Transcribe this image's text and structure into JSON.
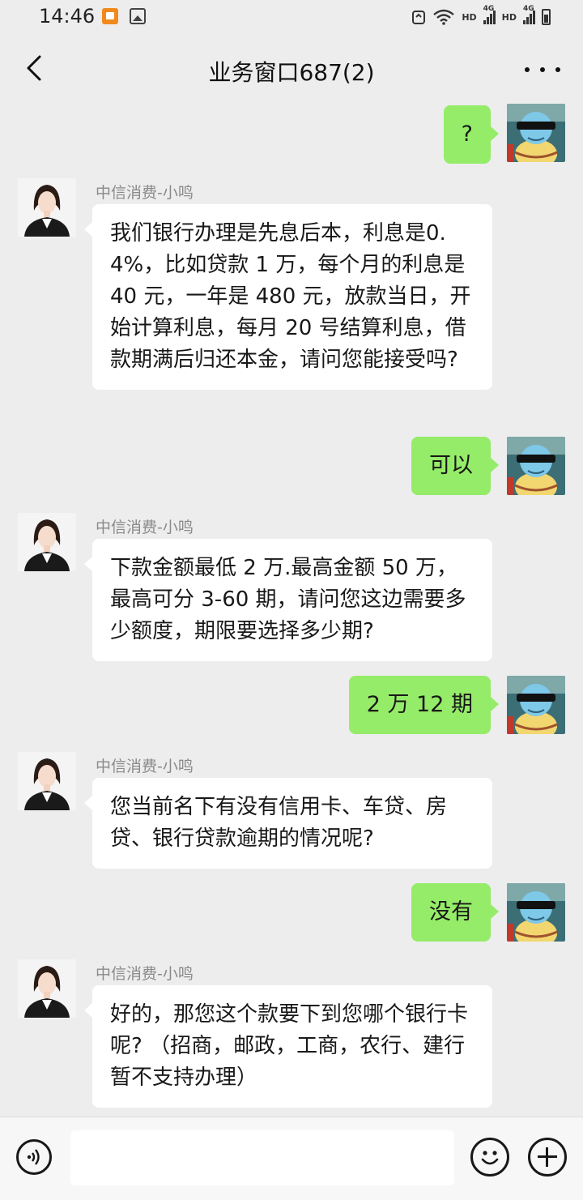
{
  "status_bar": {
    "time": "14:46",
    "signal_1_label": "HD",
    "signal_1_tech": "4G",
    "signal_2_label": "HD",
    "signal_2_tech": "4G",
    "icons": [
      "app-notification-icon",
      "gallery-icon",
      "data-saver-icon",
      "wifi-icon",
      "signal-icon",
      "battery-charging-icon"
    ]
  },
  "nav": {
    "title": "业务窗口687(2)",
    "back_icon": "chevron-left-icon",
    "more_icon": "more-dots-icon"
  },
  "chat": {
    "messages": [
      {
        "side": "right",
        "text": "?"
      },
      {
        "side": "left",
        "sender": "中信消费-小鸣",
        "text": "我们银行办理是先息后本，利息是0.4%，比如贷款 1 万，每个月的利息是 40 元，一年是 480 元，放款当日，开始计算利息，每月 20 号结算利息，借款期满后归还本金，请问您能接受吗?"
      },
      {
        "side": "right",
        "text": "可以"
      },
      {
        "side": "left",
        "sender": "中信消费-小鸣",
        "text": "下款金额最低 2 万.最高金额 50 万，最高可分 3-60 期，请问您这边需要多少额度，期限要选择多少期?"
      },
      {
        "side": "right",
        "text": "2 万 12 期"
      },
      {
        "side": "left",
        "sender": "中信消费-小鸣",
        "text": "您当前名下有没有信用卡、车贷、房贷、银行贷款逾期的情况呢?"
      },
      {
        "side": "right",
        "text": "没有"
      },
      {
        "side": "left",
        "sender": "中信消费-小鸣",
        "text": "好的，那您这个款要下到您哪个银行卡呢? （招商，邮政，工商，农行、建行暂不支持办理）"
      }
    ]
  },
  "input_bar": {
    "placeholder": "",
    "voice_icon": "voice-input-icon",
    "emoji_icon": "emoji-icon",
    "plus_icon": "plus-icon"
  },
  "colors": {
    "background": "#ededed",
    "sent_bubble": "#95ec69",
    "received_bubble": "#ffffff",
    "sender_name": "#8a8a8a"
  }
}
